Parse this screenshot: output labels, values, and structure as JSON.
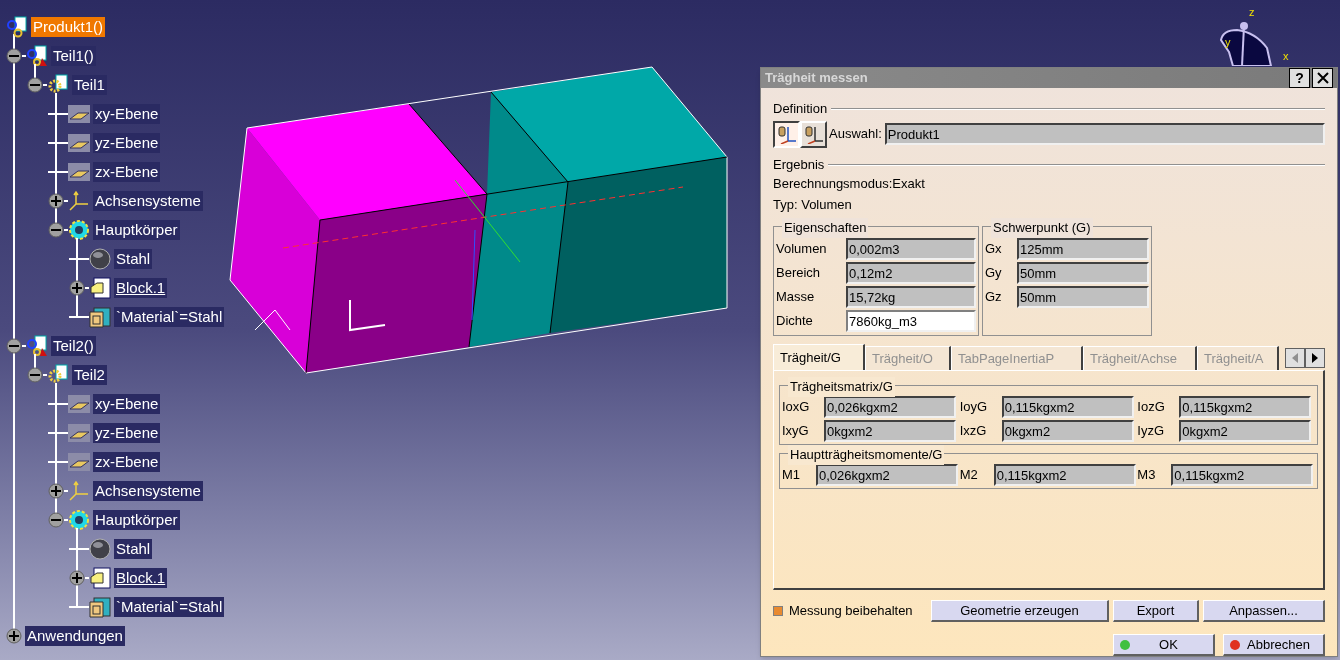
{
  "tree": [
    {
      "label": "Produkt1()",
      "kind": "product",
      "selected": true,
      "underlined": false,
      "children": [
        {
          "label": "Teil1()",
          "kind": "part-instance",
          "selected": false,
          "underlined": false,
          "expanded": true,
          "children": [
            {
              "label": "Teil1",
              "kind": "part",
              "selected": false,
              "underlined": false,
              "expanded": true,
              "children": [
                {
                  "label": "xy-Ebene",
                  "kind": "plane",
                  "selected": false,
                  "underlined": false
                },
                {
                  "label": "yz-Ebene",
                  "kind": "plane",
                  "selected": false,
                  "underlined": false
                },
                {
                  "label": "zx-Ebene",
                  "kind": "plane",
                  "selected": false,
                  "underlined": false
                },
                {
                  "label": "Achsensysteme",
                  "kind": "axes",
                  "selected": false,
                  "underlined": false,
                  "expanded": false
                },
                {
                  "label": "Hauptkörper",
                  "kind": "body",
                  "selected": false,
                  "underlined": false,
                  "expanded": true,
                  "children": [
                    {
                      "label": "Stahl",
                      "kind": "material",
                      "selected": false,
                      "underlined": false
                    },
                    {
                      "label": "Block.1",
                      "kind": "pad",
                      "selected": false,
                      "underlined": true,
                      "expanded": false
                    },
                    {
                      "label": "`Material`=Stahl",
                      "kind": "parameter",
                      "selected": false,
                      "underlined": false
                    }
                  ]
                }
              ]
            }
          ]
        },
        {
          "label": "Teil2()",
          "kind": "part-instance",
          "selected": false,
          "underlined": false,
          "expanded": true,
          "children": [
            {
              "label": "Teil2",
              "kind": "part",
              "selected": false,
              "underlined": false,
              "expanded": true,
              "children": [
                {
                  "label": "xy-Ebene",
                  "kind": "plane",
                  "selected": false,
                  "underlined": false
                },
                {
                  "label": "yz-Ebene",
                  "kind": "plane",
                  "selected": false,
                  "underlined": false
                },
                {
                  "label": "zx-Ebene",
                  "kind": "plane",
                  "selected": false,
                  "underlined": false
                },
                {
                  "label": "Achsensysteme",
                  "kind": "axes",
                  "selected": false,
                  "underlined": false,
                  "expanded": false
                },
                {
                  "label": "Hauptkörper",
                  "kind": "body",
                  "selected": false,
                  "underlined": false,
                  "expanded": true,
                  "children": [
                    {
                      "label": "Stahl",
                      "kind": "material",
                      "selected": false,
                      "underlined": false
                    },
                    {
                      "label": "Block.1",
                      "kind": "pad",
                      "selected": false,
                      "underlined": true,
                      "expanded": false
                    },
                    {
                      "label": "`Material`=Stahl",
                      "kind": "parameter",
                      "selected": false,
                      "underlined": false
                    }
                  ]
                }
              ]
            }
          ]
        }
      ]
    },
    {
      "label": "Anwendungen",
      "kind": "applications",
      "selected": false,
      "underlined": false,
      "expanded": false
    }
  ],
  "compass": {
    "labels": [
      "z",
      "y",
      "x"
    ]
  },
  "dialog": {
    "title": "Trägheit messen",
    "help_button": "?",
    "definition": {
      "heading": "Definition",
      "mode_buttons": [
        {
          "selected": true
        },
        {
          "selected": false
        }
      ],
      "selection_label": "Auswahl:",
      "selection_value": "Produkt1"
    },
    "result": {
      "heading": "Ergebnis",
      "lines": [
        "Berechnungsmodus:Exakt",
        "Typ: Volumen"
      ]
    },
    "properties": {
      "heading": "Eigenschaften",
      "rows": [
        {
          "label": "Volumen",
          "value": "0,002m3",
          "editable": false
        },
        {
          "label": "Bereich",
          "value": "0,12m2",
          "editable": false
        },
        {
          "label": "Masse",
          "value": "15,72kg",
          "editable": false
        },
        {
          "label": "Dichte",
          "value": "7860kg_m3",
          "editable": true
        }
      ]
    },
    "center_of_gravity": {
      "heading": "Schwerpunkt (G)",
      "rows": [
        {
          "label": "Gx",
          "value": "125mm"
        },
        {
          "label": "Gy",
          "value": "50mm"
        },
        {
          "label": "Gz",
          "value": "50mm"
        }
      ]
    },
    "tabs": [
      {
        "label": "Trägheit/G",
        "selected": true
      },
      {
        "label": "Trägheit/O",
        "selected": false
      },
      {
        "label": "TabPageInertiaP",
        "selected": false
      },
      {
        "label": "Trägheit/Achse",
        "selected": false
      },
      {
        "label": "Trägheit/A",
        "selected": false
      }
    ],
    "inertia_matrix": {
      "heading": "Trägheitsmatrix/G",
      "cells": [
        {
          "label": "IoxG",
          "value": "0,026kgxm2"
        },
        {
          "label": "IoyG",
          "value": "0,115kgxm2"
        },
        {
          "label": "IozG",
          "value": "0,115kgxm2"
        },
        {
          "label": "IxyG",
          "value": "0kgxm2"
        },
        {
          "label": "IxzG",
          "value": "0kgxm2"
        },
        {
          "label": "IyzG",
          "value": "0kgxm2"
        }
      ]
    },
    "principal_moments": {
      "heading": "Hauptträgheitsmomente/G",
      "cells": [
        {
          "label": "M1",
          "value": "0,026kgxm2"
        },
        {
          "label": "M2",
          "value": "0,115kgxm2"
        },
        {
          "label": "M3",
          "value": "0,115kgxm2"
        }
      ]
    },
    "keep_measure": {
      "label": "Messung beibehalten",
      "checked": true
    },
    "action_buttons": [
      "Geometrie erzeugen",
      "Export",
      "Anpassen..."
    ],
    "ok_button": "OK",
    "cancel_button": "Abbrechen"
  }
}
